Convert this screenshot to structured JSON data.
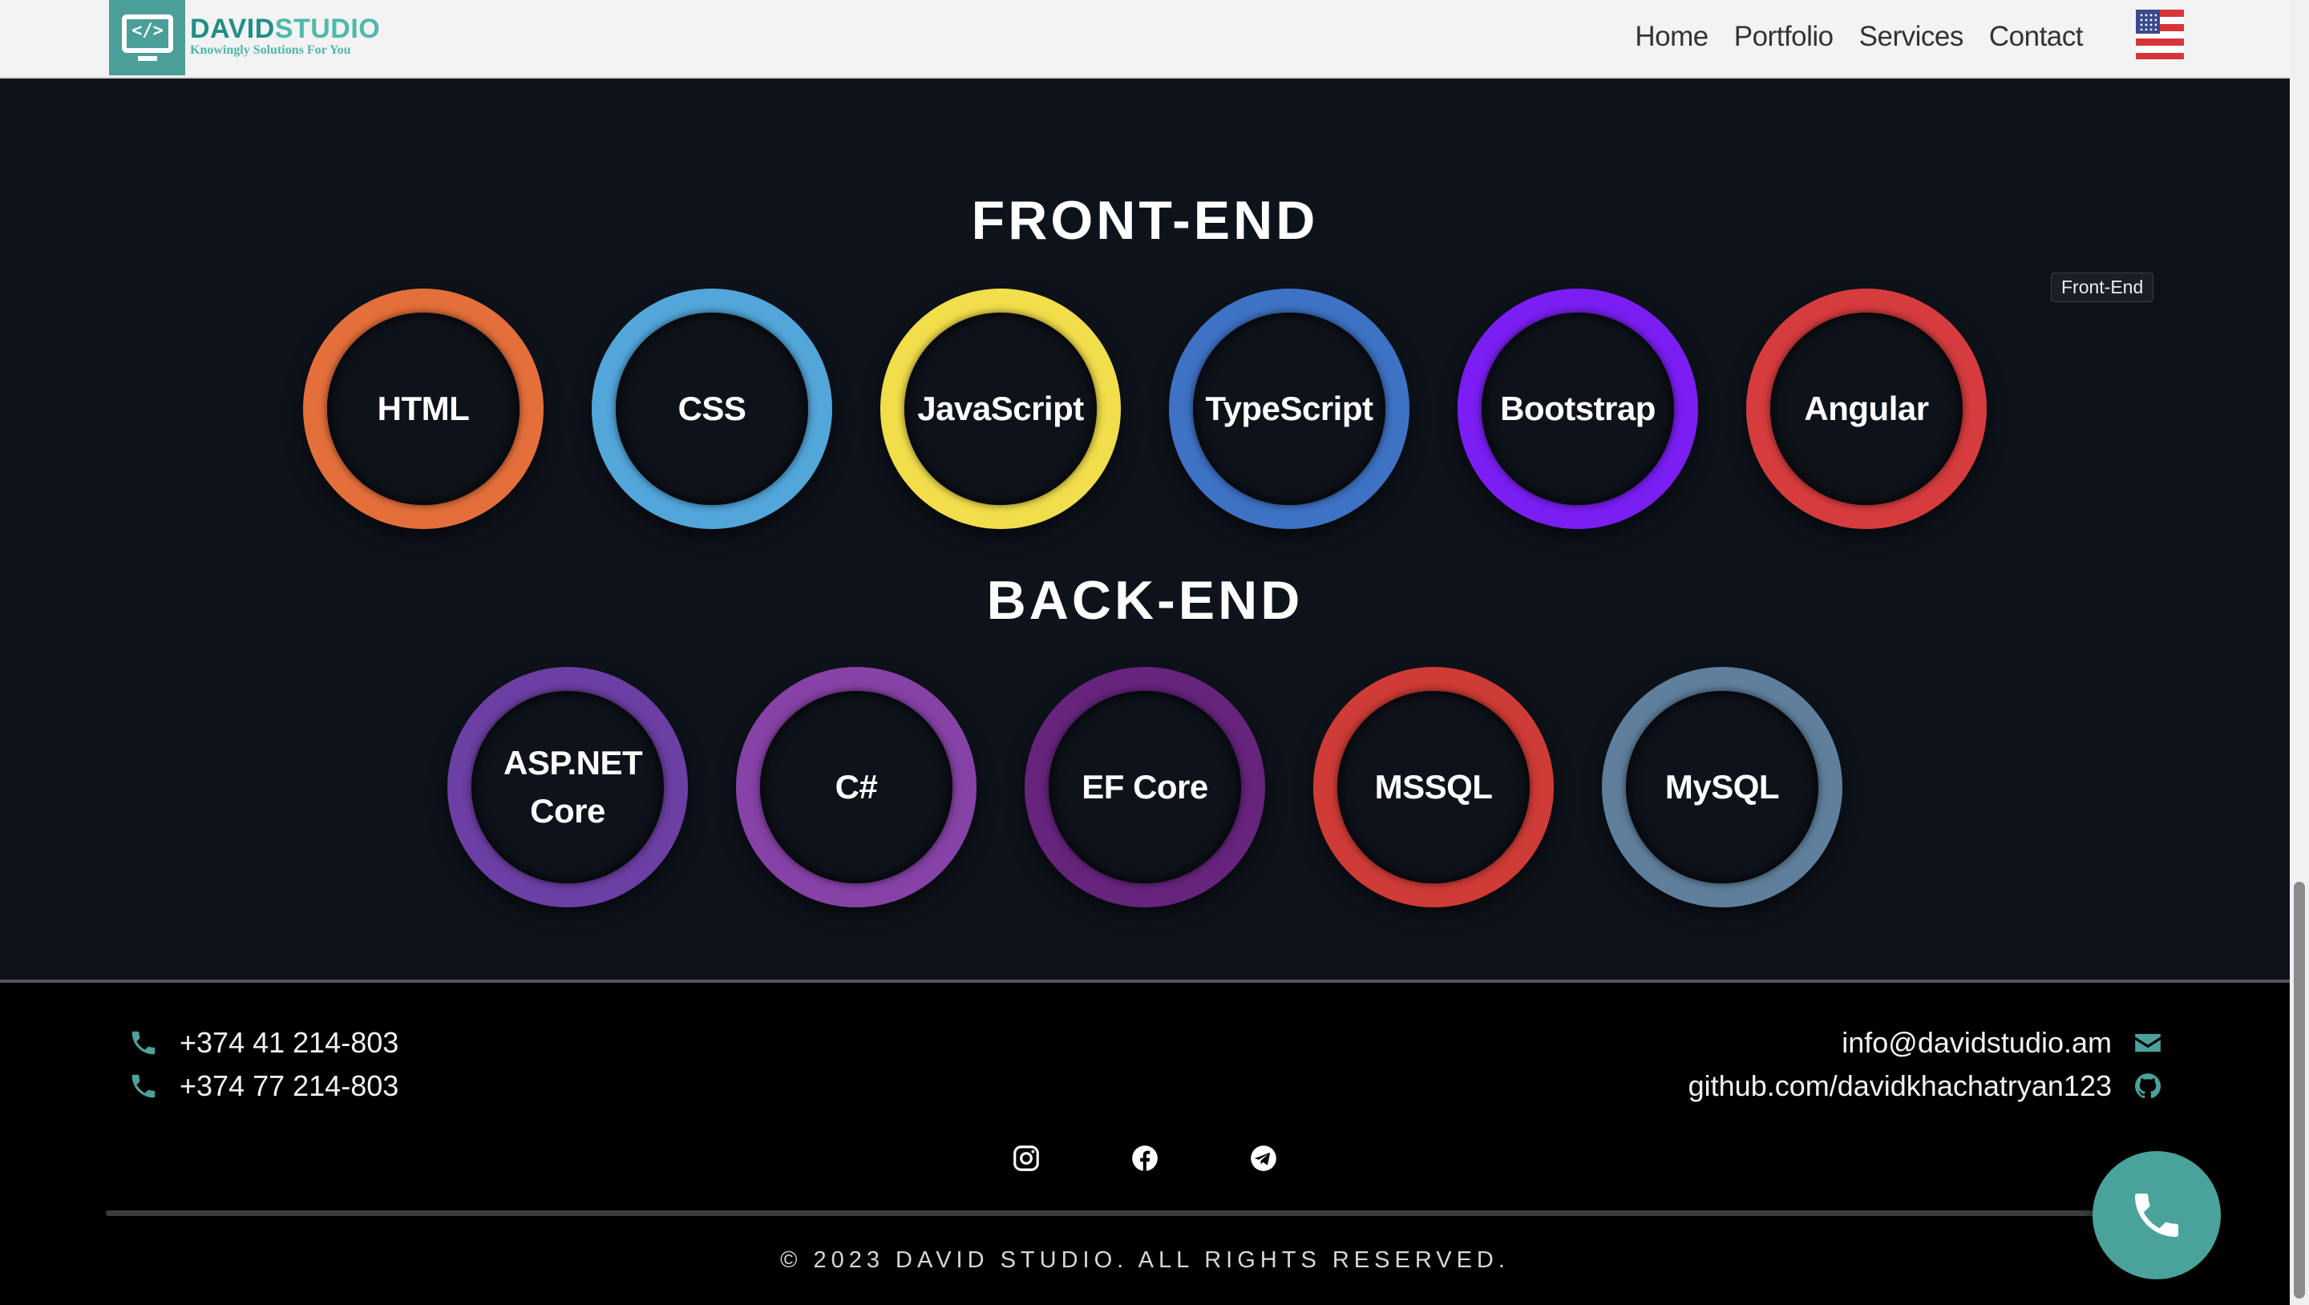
{
  "header": {
    "logo_name_part1": "DAVID",
    "logo_name_part2": "STUDIO",
    "logo_tagline": "Knowingly Solutions For You",
    "logo_glyph": "</>",
    "nav": [
      "Home",
      "Portfolio",
      "Services",
      "Contact"
    ],
    "language_flag": "us-flag-icon"
  },
  "tooltip": "Front-End",
  "frontend": {
    "title": "FRONT-END",
    "items": [
      {
        "label": "HTML",
        "color": "#e46f3a"
      },
      {
        "label": "CSS",
        "color": "#52a6da"
      },
      {
        "label": "JavaScript",
        "color": "#f2dd4a"
      },
      {
        "label": "TypeScript",
        "color": "#3e72c4"
      },
      {
        "label": "Bootstrap",
        "color": "#7a1ef3"
      },
      {
        "label": "Angular",
        "color": "#d63c3e"
      }
    ]
  },
  "backend": {
    "title": "BACK-END",
    "items": [
      {
        "label": "ASP.NET Core",
        "color": "#6b3fa3"
      },
      {
        "label": "C#",
        "color": "#8642a6"
      },
      {
        "label": "EF Core",
        "color": "#66247d"
      },
      {
        "label": "MSSQL",
        "color": "#cf3b36"
      },
      {
        "label": "MySQL",
        "color": "#5f7f9c"
      }
    ]
  },
  "footer": {
    "phones": [
      "+374 41 214-803",
      "+374 77 214-803"
    ],
    "email": "info@davidstudio.am",
    "github": "github.com/davidkhachatryan123",
    "socials": [
      "instagram-icon",
      "facebook-icon",
      "telegram-icon"
    ],
    "copyright": "© 2023 DAVID STUDIO. ALL RIGHTS RESERVED."
  },
  "colors": {
    "accent": "#4aa39b",
    "background": "#0e131b",
    "footer": "#000000"
  }
}
